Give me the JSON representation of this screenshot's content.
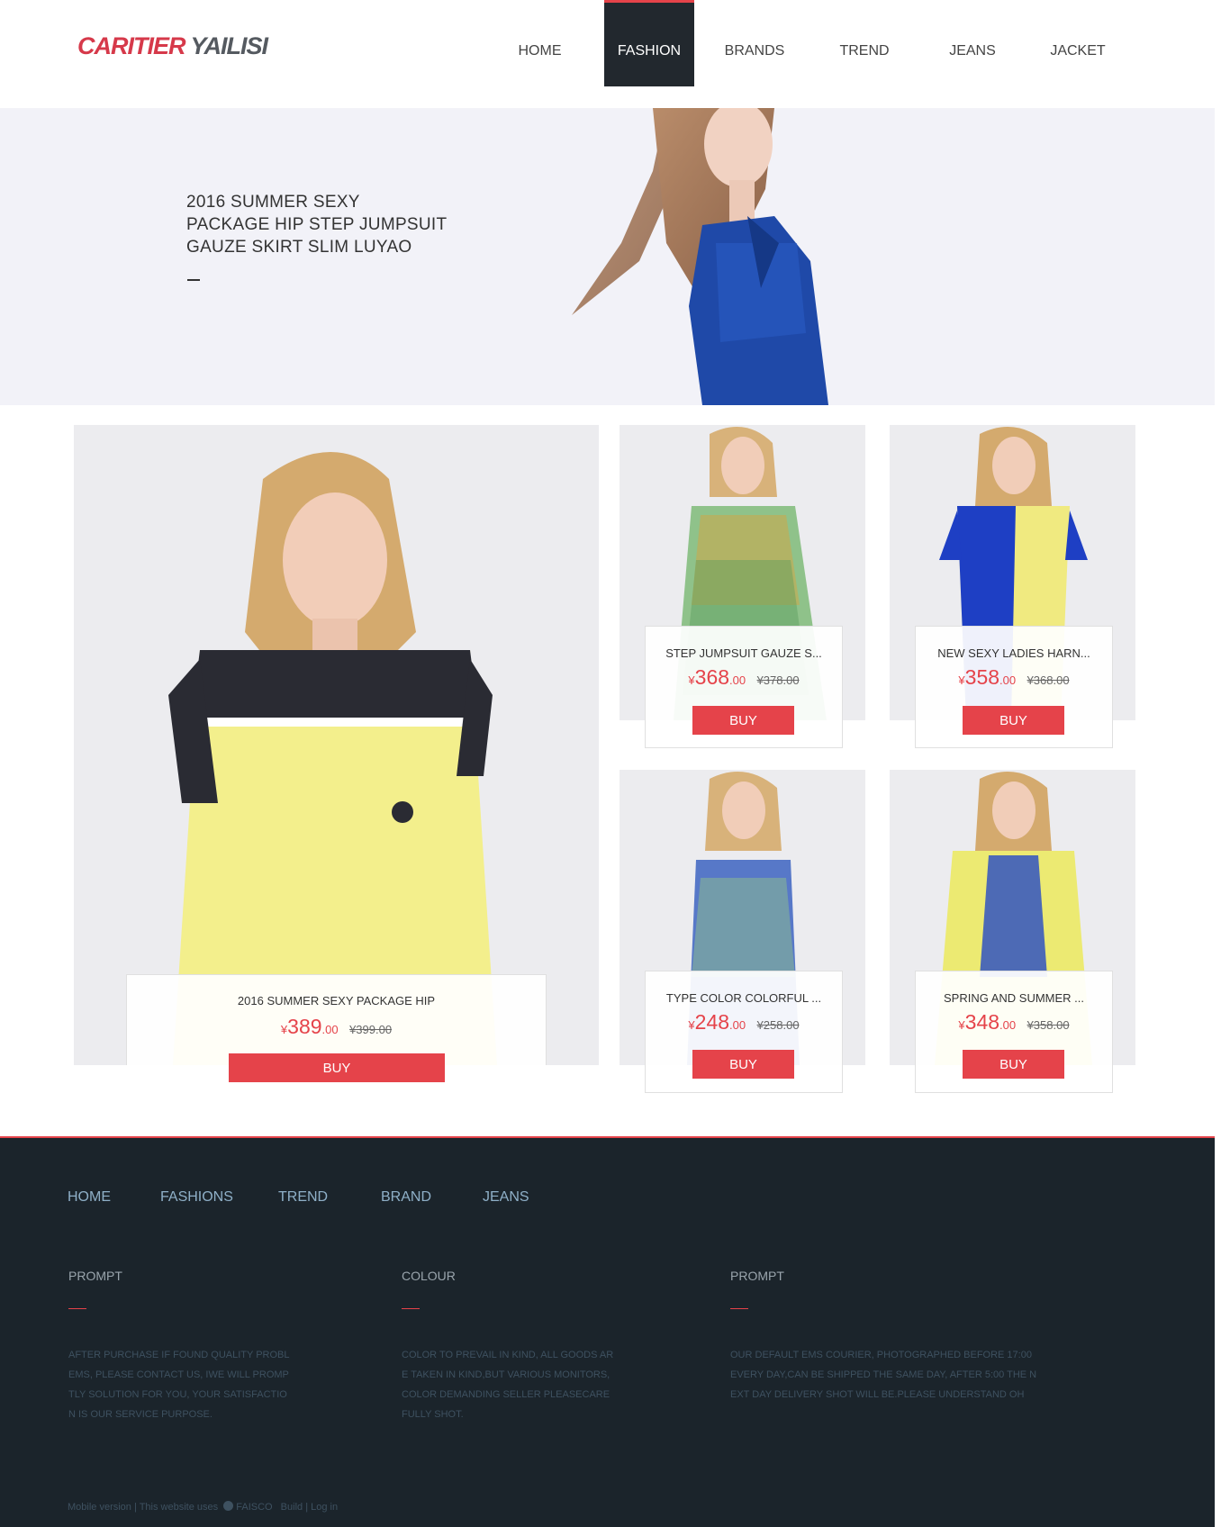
{
  "brand": {
    "logo_red": "CARITIER",
    "logo_gray": "YAILISI"
  },
  "nav": {
    "items": [
      {
        "label": "HOME"
      },
      {
        "label": "FASHION",
        "active": true
      },
      {
        "label": "BRANDS"
      },
      {
        "label": "TREND"
      },
      {
        "label": "JEANS"
      },
      {
        "label": "JACKET"
      }
    ]
  },
  "hero": {
    "lines": [
      "2016 SUMMER SEXY",
      "PACKAGE HIP STEP JUMPSUIT",
      "GAUZE SKIRT SLIM LUYAO"
    ],
    "dash": "—"
  },
  "products": [
    {
      "name": "2016 SUMMER SEXY PACKAGE HIP",
      "currency": "¥",
      "price_int": "389",
      "price_dec": ".00",
      "old_price": "¥399.00",
      "buy_label": "BUY"
    },
    {
      "name": "STEP JUMPSUIT GAUZE S...",
      "currency": "¥",
      "price_int": "368",
      "price_dec": ".00",
      "old_price": "¥378.00",
      "buy_label": "BUY"
    },
    {
      "name": "NEW SEXY LADIES HARN...",
      "currency": "¥",
      "price_int": "358",
      "price_dec": ".00",
      "old_price": "¥368.00",
      "buy_label": "BUY"
    },
    {
      "name": "TYPE COLOR COLORFUL ...",
      "currency": "¥",
      "price_int": "248",
      "price_dec": ".00",
      "old_price": "¥258.00",
      "buy_label": "BUY"
    },
    {
      "name": "SPRING AND SUMMER ...",
      "currency": "¥",
      "price_int": "348",
      "price_dec": ".00",
      "old_price": "¥358.00",
      "buy_label": "BUY"
    }
  ],
  "footer": {
    "nav": [
      "HOME",
      "FASHIONS",
      "TREND",
      "BRAND",
      "JEANS"
    ],
    "columns": [
      {
        "title": "PROMPT",
        "lines": [
          "AFTER PURCHASE IF FOUND QUALITY PROBL",
          "EMS, PLEASE CONTACT US, IWE WILL PROMP",
          "TLY SOLUTION FOR YOU, YOUR SATISFACTIO",
          "N IS OUR SERVICE PURPOSE."
        ]
      },
      {
        "title": "COLOUR",
        "lines": [
          "COLOR TO PREVAIL IN KIND, ALL GOODS AR",
          "E TAKEN IN KIND,BUT VARIOUS MONITORS,",
          "COLOR DEMANDING SELLER PLEASECARE",
          "FULLY SHOT."
        ]
      },
      {
        "title": "PROMPT",
        "lines": [
          "OUR DEFAULT EMS COURIER, PHOTOGRAPHED BEFORE 17:00",
          "EVERY DAY,CAN BE SHIPPED THE SAME DAY, AFTER 5:00 THE N",
          "EXT DAY DELIVERY SHOT WILL BE.PLEASE UNDERSTAND OH"
        ]
      }
    ],
    "copyright": {
      "mobile": "Mobile version",
      "uses": "This website uses",
      "faisco": "FAISCO",
      "build": "Build",
      "login": "Log in"
    }
  },
  "colors": {
    "accent": "#e5434a",
    "footer_bg": "#1b242b",
    "nav_active_bg": "#22282e"
  },
  "icons": {
    "faisco": "faisco-logo-icon"
  }
}
